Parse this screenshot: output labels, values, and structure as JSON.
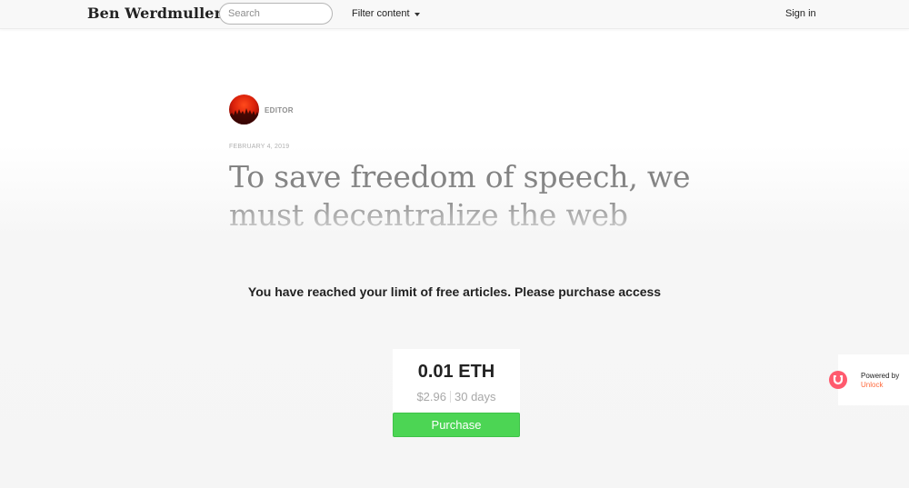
{
  "navbar": {
    "brand": "Ben Werdmuller",
    "search_placeholder": "Search",
    "filter_label": "Filter content",
    "signin_label": "Sign in"
  },
  "article": {
    "author_role": "EDITOR",
    "date": "FEBRUARY 4, 2019",
    "title": "To save freedom of speech, we must decentralize the web"
  },
  "paywall": {
    "message": "You have reached your limit of free articles. Please purchase access",
    "price": "0.01 ETH",
    "fiat_price": "$2.96",
    "duration": "30 days",
    "purchase_label": "Purchase",
    "accent_color": "#4cd554"
  },
  "badge": {
    "powered_by": "Powered by",
    "brand": "Unlock",
    "brand_color": "#ff6a3d",
    "icon": "unlock-logo-icon"
  }
}
